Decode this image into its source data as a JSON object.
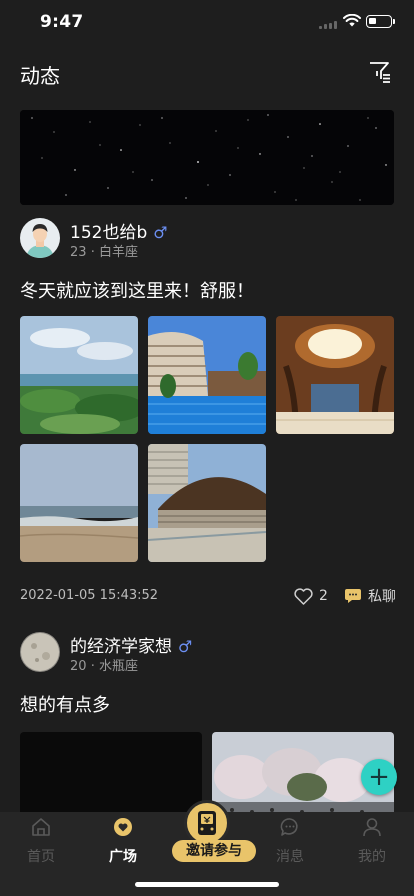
{
  "status_bar": {
    "time": "9:47"
  },
  "header": {
    "title": "动态",
    "filter_icon": "filter-icon"
  },
  "posts": [
    {
      "username": "152也给b",
      "gender": "♂",
      "age": "23",
      "zodiac": "白羊座",
      "text": "冬天就应该到这里来！舒服！",
      "time": "2022-01-05 15:43:52",
      "likes": "2",
      "chat_label": "私聊"
    },
    {
      "username": "的经济学家想",
      "gender": "♂",
      "age": "20",
      "zodiac": "水瓶座",
      "text": "想的有点多"
    }
  ],
  "meta_separator": "·",
  "fab": {
    "label": "+"
  },
  "tabs": [
    {
      "label": "首页",
      "icon": "home-icon"
    },
    {
      "label": "广场",
      "icon": "heart-badge-icon"
    },
    {
      "label": "邀请参与",
      "icon": "invite-icon"
    },
    {
      "label": "消息",
      "icon": "message-icon"
    },
    {
      "label": "我的",
      "icon": "profile-icon"
    }
  ],
  "colors": {
    "background": "#1e1e1e",
    "accent_gold": "#e9c46a",
    "fab": "#2ed1c4",
    "gender_male": "#6c8ff2"
  }
}
